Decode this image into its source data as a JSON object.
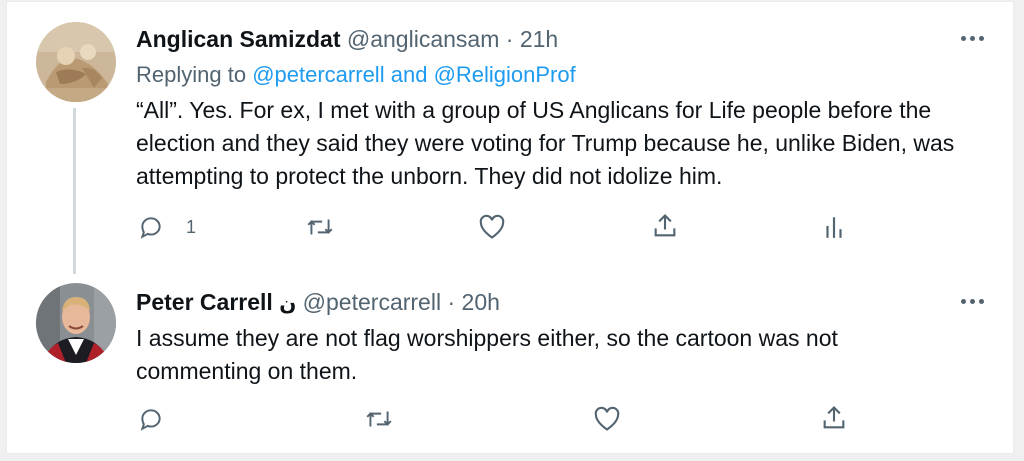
{
  "tweets": [
    {
      "name": "Anglican Samizdat",
      "handle": "@anglicansam",
      "separator": "·",
      "time": "21h",
      "replying_prefix": "Replying to",
      "replying_to_1": "@petercarrell",
      "replying_and": "and",
      "replying_to_2": "@ReligionProf",
      "text": "“All”. Yes. For ex, I met with a group of US Anglicans for Life people before the election and they said they were voting for Trump because he, unlike Biden, was attempting to protect the unborn. They did not idolize him.",
      "reply_count": "1"
    },
    {
      "name": "Peter Carrell",
      "name_suffix": "ن",
      "handle": "@petercarrell",
      "separator": "·",
      "time": "20h",
      "text": "I assume they are not flag worshippers either, so the cartoon was not commenting on them."
    }
  ],
  "icons": {
    "reply": "reply-icon",
    "retweet": "retweet-icon",
    "like": "heart-icon",
    "share": "share-icon",
    "analytics": "analytics-icon",
    "more": "more-icon"
  },
  "colors": {
    "link": "#1d9bf0",
    "secondary": "#536471",
    "text": "#0f1419",
    "thread_line": "#cfd9de"
  }
}
